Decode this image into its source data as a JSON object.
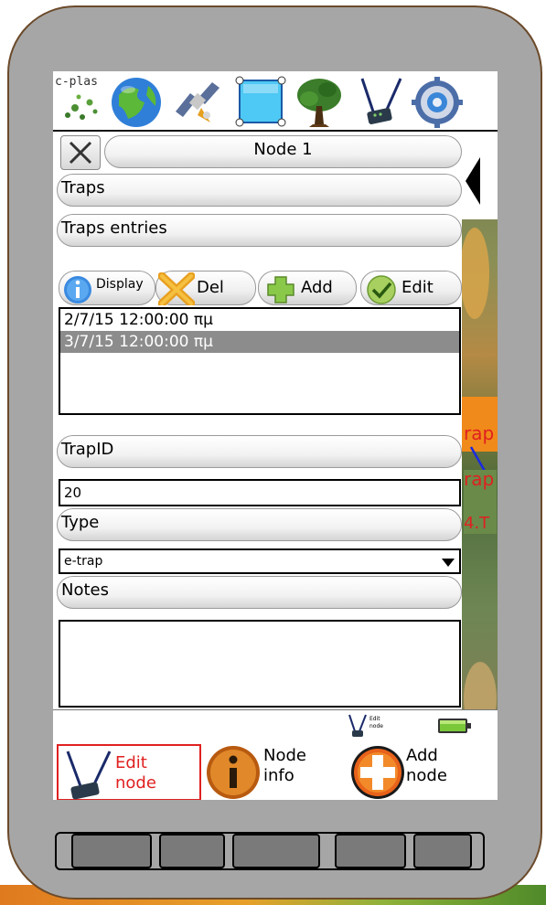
{
  "toolbar": {
    "logo_text": "c-plas",
    "icons": [
      "globe-icon",
      "satellite-icon",
      "selection-square-icon",
      "tree-icon",
      "antenna-node-icon",
      "settings-gear-icon"
    ]
  },
  "node_panel": {
    "title": "Node 1",
    "sections": {
      "traps": "Traps",
      "traps_entries": "Traps entries"
    },
    "actions": {
      "display": "Display",
      "del": "Del",
      "add": "Add",
      "edit": "Edit"
    },
    "entries": [
      {
        "text": "2/7/15 12:00:00 πμ",
        "selected": false
      },
      {
        "text": "3/7/15 12:00:00 πμ",
        "selected": true
      }
    ],
    "fields": {
      "trapid_label": "TrapID",
      "trapid_value": "20",
      "type_label": "Type",
      "type_value": "e-trap",
      "notes_label": "Notes",
      "notes_value": ""
    }
  },
  "map_labels": {
    "label1": "rap",
    "label2": "rap",
    "label3": "4.T"
  },
  "status": {
    "mode_line1": "Edit",
    "mode_line2": "node"
  },
  "bottom_nav": {
    "edit_node": {
      "line1": "Edit",
      "line2": "node"
    },
    "node_info": {
      "line1": "Node",
      "line2": "info"
    },
    "add_node": {
      "line1": "Add",
      "line2": "node"
    }
  },
  "colors": {
    "device_body": "#a6a6a6",
    "device_border": "#6b4a2a",
    "active_nav": "#e02020",
    "selected_row": "#8c8c8c",
    "map_label": "#e02020"
  }
}
